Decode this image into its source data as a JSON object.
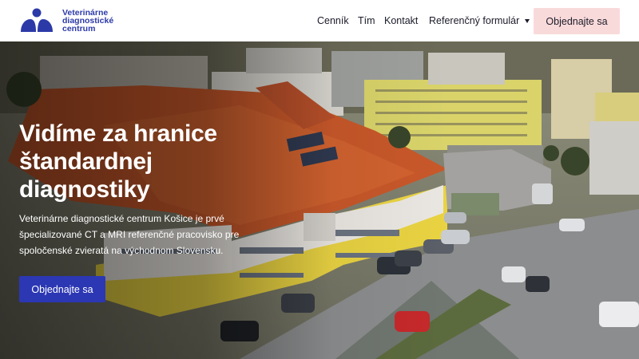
{
  "logo": {
    "line1": "Veterinárne",
    "line2": "diagnostické",
    "line3": "centrum",
    "icon": "paw-logo-icon",
    "color": "#2c3aa8"
  },
  "nav": {
    "items": [
      {
        "label": "Cenník"
      },
      {
        "label": "Tím"
      },
      {
        "label": "Kontakt"
      },
      {
        "label": "Referenčný formulár",
        "icon": "caret-down-icon"
      }
    ],
    "cta_label": "Objednajte sa",
    "cta_color": "#f9dada"
  },
  "hero": {
    "title": "Vidíme za hranice štandardnej diagnostiky",
    "text": "Veterinárne diagnostické centrum Košice je prvé špecializované CT a MRI referenčné pracovisko pre spoločenské zvieratá na východnom Slovensku.",
    "cta_label": "Objednajte sa",
    "cta_color": "#2b37b3"
  }
}
